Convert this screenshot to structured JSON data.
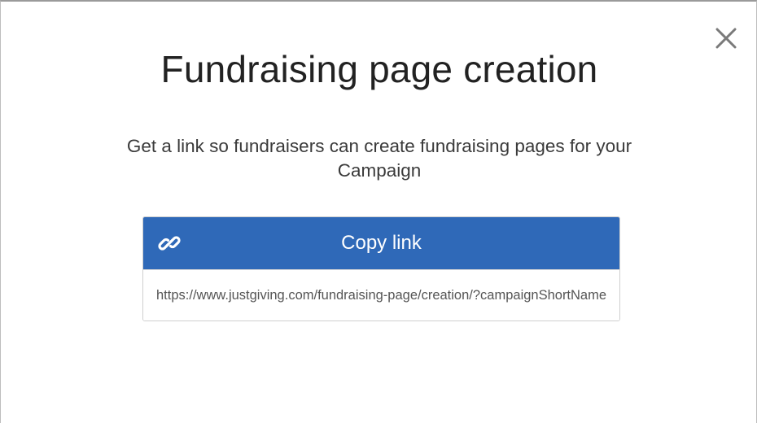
{
  "dialog": {
    "title": "Fundraising page creation",
    "description": "Get a link so fundraisers can create fundraising pages for your Campaign",
    "close_icon": "close-icon"
  },
  "copy": {
    "button_label": "Copy link",
    "icon": "link-icon",
    "url_value": "https://www.justgiving.com/fundraising-page/creation/?campaignShortName",
    "accent_color": "#2f69b8"
  }
}
